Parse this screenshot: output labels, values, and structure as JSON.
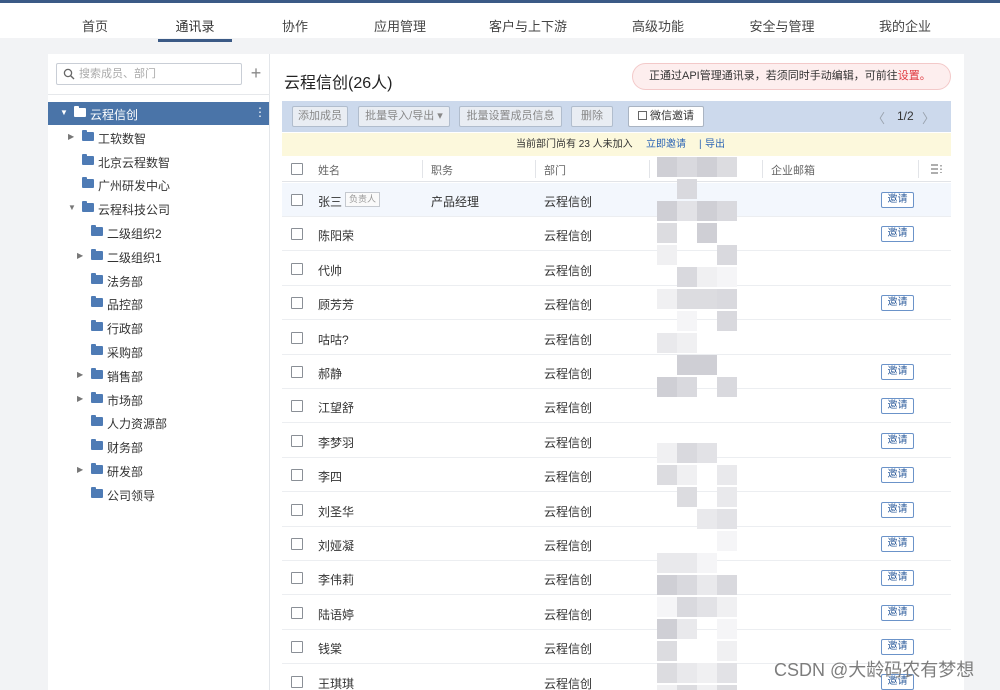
{
  "topnav": {
    "items": [
      {
        "label": "首页",
        "active": false
      },
      {
        "label": "通讯录",
        "active": true
      },
      {
        "label": "协作",
        "active": false
      },
      {
        "label": "应用管理",
        "active": false
      },
      {
        "label": "客户与上下游",
        "active": false
      },
      {
        "label": "高级功能",
        "active": false
      },
      {
        "label": "安全与管理",
        "active": false
      },
      {
        "label": "我的企业",
        "active": false
      }
    ]
  },
  "sidebar": {
    "search_placeholder": "搜索成员、部门",
    "add_icon": "plus-icon",
    "tree": [
      {
        "label": "云程信创",
        "level": 0,
        "expanded": true,
        "has_children": true,
        "selected": true
      },
      {
        "label": "工软数智",
        "level": 1,
        "expanded": false,
        "has_children": true,
        "selected": false
      },
      {
        "label": "北京云程数智",
        "level": 1,
        "expanded": false,
        "has_children": false,
        "selected": false
      },
      {
        "label": "广州研发中心",
        "level": 1,
        "expanded": false,
        "has_children": false,
        "selected": false
      },
      {
        "label": "云程科技公司",
        "level": 1,
        "expanded": true,
        "has_children": true,
        "selected": false
      },
      {
        "label": "二级组织2",
        "level": 2,
        "expanded": false,
        "has_children": false,
        "selected": false
      },
      {
        "label": "二级组织1",
        "level": 2,
        "expanded": false,
        "has_children": true,
        "selected": false
      },
      {
        "label": "法务部",
        "level": 2,
        "expanded": false,
        "has_children": false,
        "selected": false
      },
      {
        "label": "品控部",
        "level": 2,
        "expanded": false,
        "has_children": false,
        "selected": false
      },
      {
        "label": "行政部",
        "level": 2,
        "expanded": false,
        "has_children": false,
        "selected": false
      },
      {
        "label": "采购部",
        "level": 2,
        "expanded": false,
        "has_children": false,
        "selected": false
      },
      {
        "label": "销售部",
        "level": 2,
        "expanded": false,
        "has_children": true,
        "selected": false
      },
      {
        "label": "市场部",
        "level": 2,
        "expanded": false,
        "has_children": true,
        "selected": false
      },
      {
        "label": "人力资源部",
        "level": 2,
        "expanded": false,
        "has_children": false,
        "selected": false
      },
      {
        "label": "财务部",
        "level": 2,
        "expanded": false,
        "has_children": false,
        "selected": false
      },
      {
        "label": "研发部",
        "level": 2,
        "expanded": false,
        "has_children": true,
        "selected": false
      },
      {
        "label": "公司领导",
        "level": 2,
        "expanded": false,
        "has_children": false,
        "selected": false
      }
    ]
  },
  "main": {
    "title": "云程信创(26人)",
    "api_notice": {
      "text": "正通过API管理通讯录，若须同时手动编辑，可前往",
      "link": "设置。"
    },
    "toolbar": {
      "add_member": "添加成员",
      "batch_import_export": "批量导入/导出 ▾",
      "batch_set_info": "批量设置成员信息",
      "delete": "删除",
      "wechat_invite": "微信邀请"
    },
    "pager": {
      "prev": "〈",
      "page": "1/2",
      "next": "〉"
    },
    "notice_bar": {
      "text": "当前部门尚有 23 人未加入",
      "invite_now": "立即邀请",
      "separator": "|",
      "export": "导出"
    },
    "table": {
      "columns": [
        "姓名",
        "职务",
        "部门",
        "手机",
        "企业邮箱"
      ],
      "leader_badge": "负责人",
      "invite_label": "邀请",
      "rows": [
        {
          "name": "张三",
          "title": "产品经理",
          "dept": "云程信创",
          "leader": true,
          "invite": true
        },
        {
          "name": "陈阳荣",
          "title": "",
          "dept": "云程信创",
          "leader": false,
          "invite": true
        },
        {
          "name": "代帅",
          "title": "",
          "dept": "云程信创",
          "leader": false,
          "invite": false
        },
        {
          "name": "顾芳芳",
          "title": "",
          "dept": "云程信创",
          "leader": false,
          "invite": true
        },
        {
          "name": "咕咕?",
          "title": "",
          "dept": "云程信创",
          "leader": false,
          "invite": false
        },
        {
          "name": "郝静",
          "title": "",
          "dept": "云程信创",
          "leader": false,
          "invite": true
        },
        {
          "name": "江望舒",
          "title": "",
          "dept": "云程信创",
          "leader": false,
          "invite": true
        },
        {
          "name": "李梦羽",
          "title": "",
          "dept": "云程信创",
          "leader": false,
          "invite": true
        },
        {
          "name": "李四",
          "title": "",
          "dept": "云程信创",
          "leader": false,
          "invite": true
        },
        {
          "name": "刘圣华",
          "title": "",
          "dept": "云程信创",
          "leader": false,
          "invite": true
        },
        {
          "name": "刘娅凝",
          "title": "",
          "dept": "云程信创",
          "leader": false,
          "invite": true
        },
        {
          "name": "李伟莉",
          "title": "",
          "dept": "云程信创",
          "leader": false,
          "invite": true
        },
        {
          "name": "陆语婷",
          "title": "",
          "dept": "云程信创",
          "leader": false,
          "invite": true
        },
        {
          "name": "钱棠",
          "title": "",
          "dept": "云程信创",
          "leader": false,
          "invite": true
        },
        {
          "name": "王琪琪",
          "title": "",
          "dept": "云程信创",
          "leader": false,
          "invite": true
        }
      ]
    }
  },
  "watermark": "CSDN @大龄码农有梦想",
  "colors": {
    "nav_accent": "#3b5a86",
    "tree_selected": "#4a74a8",
    "toolbar_bg": "#ccd9ec",
    "notice_bg": "#fcf8dc",
    "link": "#2b64b5",
    "api_link": "#e0383e"
  }
}
